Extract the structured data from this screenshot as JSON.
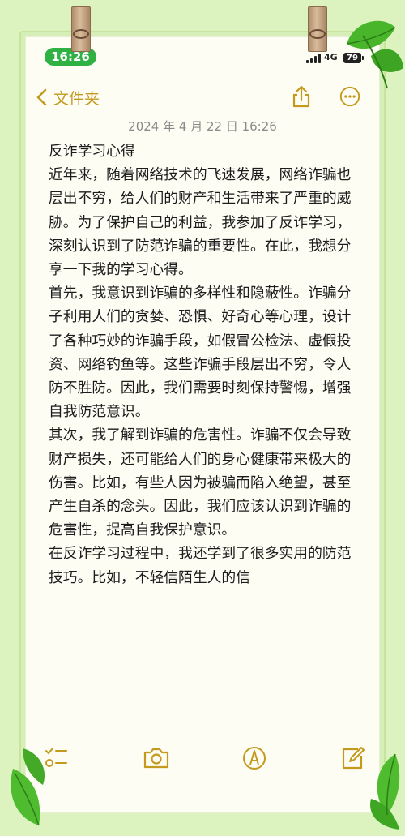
{
  "status_bar": {
    "time": "16:26",
    "network": "4G",
    "battery": "79"
  },
  "nav": {
    "back_label": "文件夹"
  },
  "note": {
    "date": "2024 年 4 月 22 日 16:26",
    "title": "反诈学习心得",
    "paragraphs": [
      "近年来，随着网络技术的飞速发展，网络诈骗也层出不穷，给人们的财产和生活带来了严重的威胁。为了保护自己的利益，我参加了反诈学习，深刻认识到了防范诈骗的重要性。在此，我想分享一下我的学习心得。",
      "首先，我意识到诈骗的多样性和隐蔽性。诈骗分子利用人们的贪婪、恐惧、好奇心等心理，设计了各种巧妙的诈骗手段，如假冒公检法、虚假投资、网络钓鱼等。这些诈骗手段层出不穷，令人防不胜防。因此，我们需要时刻保持警惕，增强自我防范意识。",
      "其次，我了解到诈骗的危害性。诈骗不仅会导致财产损失，还可能给人们的身心健康带来极大的伤害。比如，有些人因为被骗而陷入绝望，甚至产生自杀的念头。因此，我们应该认识到诈骗的危害性，提高自我保护意识。",
      "在反诈学习过程中，我还学到了很多实用的防范技巧。比如，不轻信陌生人的信"
    ]
  },
  "toolbar": {
    "items": [
      "checklist-icon",
      "camera-icon",
      "markup-icon",
      "compose-icon"
    ]
  },
  "colors": {
    "accent": "#c49a1e",
    "status_green": "#2fb144",
    "background": "#dcf3c0"
  }
}
